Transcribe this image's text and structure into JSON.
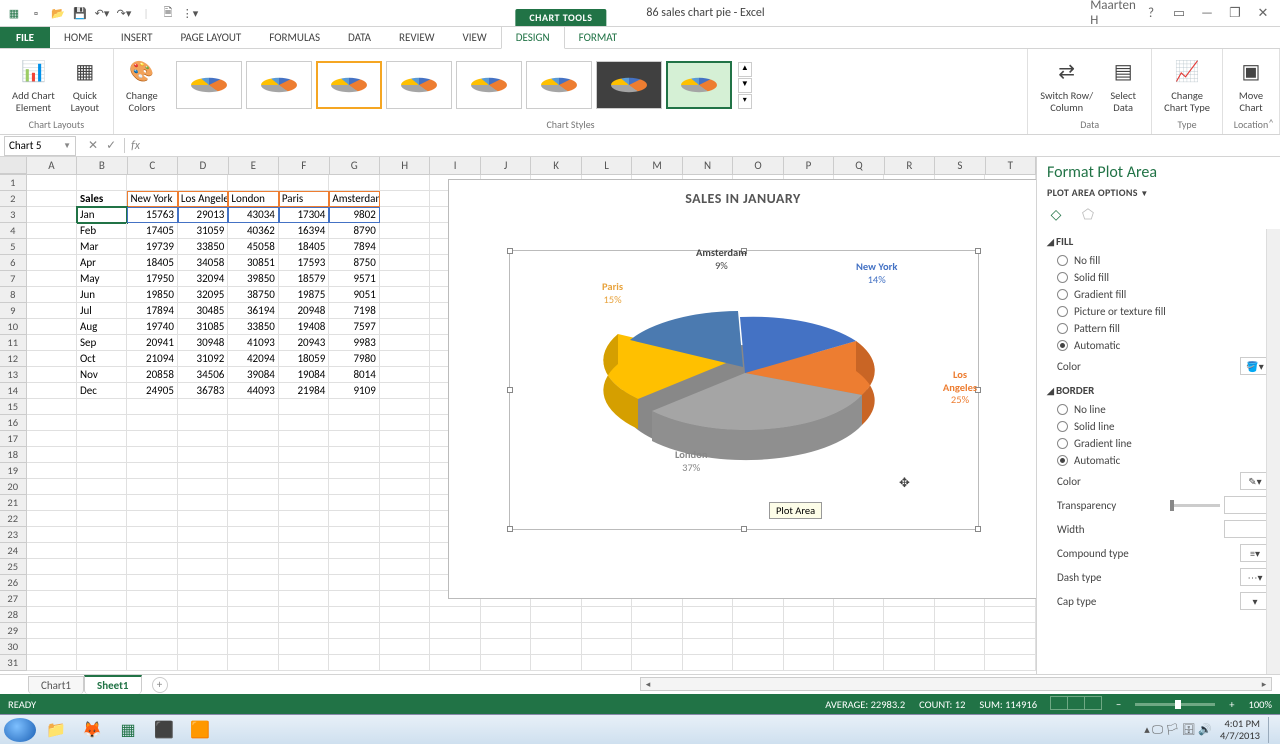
{
  "window": {
    "doc_title": "86 sales chart pie - Excel",
    "chart_tools": "CHART TOOLS",
    "user": "Maarten H"
  },
  "ribbon": {
    "tabs": [
      "FILE",
      "HOME",
      "INSERT",
      "PAGE LAYOUT",
      "FORMULAS",
      "DATA",
      "REVIEW",
      "VIEW",
      "DESIGN",
      "FORMAT"
    ],
    "groups": {
      "layouts": "Chart Layouts",
      "styles": "Chart Styles",
      "data": "Data",
      "type": "Type",
      "location": "Location"
    },
    "buttons": {
      "add_element": "Add Chart\nElement",
      "quick_layout": "Quick\nLayout",
      "change_colors": "Change\nColors",
      "switch_rc": "Switch Row/\nColumn",
      "select_data": "Select\nData",
      "change_type": "Change\nChart Type",
      "move_chart": "Move\nChart"
    }
  },
  "formula": {
    "namebox": "Chart 5",
    "fx": "fx"
  },
  "columns": [
    "A",
    "B",
    "C",
    "D",
    "E",
    "F",
    "G",
    "H",
    "I",
    "J",
    "K",
    "L",
    "M",
    "N",
    "O",
    "P",
    "Q",
    "R",
    "S",
    "T"
  ],
  "chart_data": {
    "type": "pie",
    "title": "SALES IN JANUARY",
    "categories": [
      "New York",
      "Los Angeles",
      "London",
      "Paris",
      "Amsterdam"
    ],
    "values": [
      15763,
      29013,
      43034,
      17304,
      9802
    ],
    "percent_labels": [
      "14%",
      "25%",
      "37%",
      "15%",
      "9%"
    ],
    "colors": [
      "#4472C4",
      "#ED7D31",
      "#A5A5A5",
      "#FFC000",
      "#5B9BD5"
    ]
  },
  "table": {
    "corner": "Sales",
    "headers": [
      "New York",
      "Los Angeles",
      "London",
      "Paris",
      "Amsterdam"
    ],
    "rows": [
      {
        "m": "Jan",
        "v": [
          15763,
          29013,
          43034,
          17304,
          9802
        ]
      },
      {
        "m": "Feb",
        "v": [
          17405,
          31059,
          40362,
          16394,
          8790
        ]
      },
      {
        "m": "Mar",
        "v": [
          19739,
          33850,
          45058,
          18405,
          7894
        ]
      },
      {
        "m": "Apr",
        "v": [
          18405,
          34058,
          30851,
          17593,
          8750
        ]
      },
      {
        "m": "May",
        "v": [
          17950,
          32094,
          39850,
          18579,
          9571
        ]
      },
      {
        "m": "Jun",
        "v": [
          19850,
          32095,
          38750,
          19875,
          9051
        ]
      },
      {
        "m": "Jul",
        "v": [
          17894,
          30485,
          36194,
          20948,
          7198
        ]
      },
      {
        "m": "Aug",
        "v": [
          19740,
          31085,
          33850,
          19408,
          7597
        ]
      },
      {
        "m": "Sep",
        "v": [
          20941,
          30948,
          41093,
          20943,
          9983
        ]
      },
      {
        "m": "Oct",
        "v": [
          21094,
          31092,
          42094,
          18059,
          7980
        ]
      },
      {
        "m": "Nov",
        "v": [
          20858,
          34506,
          39084,
          19084,
          8014
        ]
      },
      {
        "m": "Dec",
        "v": [
          24905,
          36783,
          44093,
          21984,
          9109
        ]
      }
    ]
  },
  "plot_tooltip": "Plot Area",
  "pane": {
    "title": "Format Plot Area",
    "sub": "PLOT AREA OPTIONS",
    "fill": {
      "h": "FILL",
      "opts": [
        "No fill",
        "Solid fill",
        "Gradient fill",
        "Picture or texture fill",
        "Pattern fill",
        "Automatic"
      ],
      "color": "Color"
    },
    "border": {
      "h": "BORDER",
      "opts": [
        "No line",
        "Solid line",
        "Gradient line",
        "Automatic"
      ],
      "color": "Color",
      "trans": "Transparency",
      "width": "Width",
      "compound": "Compound type",
      "dash": "Dash type",
      "cap": "Cap type"
    }
  },
  "sheets": {
    "tabs": [
      "Chart1",
      "Sheet1"
    ],
    "active": 1
  },
  "status": {
    "ready": "READY",
    "avg": "AVERAGE: 22983.2",
    "count": "COUNT: 12",
    "sum": "SUM: 114916",
    "zoom": "100%"
  },
  "clock": {
    "time": "4:01 PM",
    "date": "4/7/2013"
  }
}
